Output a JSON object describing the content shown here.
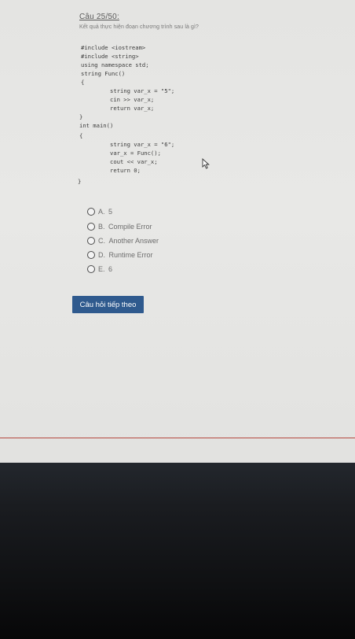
{
  "question": {
    "title": "Câu 25/50:",
    "text": "Kết quả thực hiện đoạn chương trình sau là gì?"
  },
  "code_lines": [
    "#include <iostream>",
    "#include <string>",
    "using namespace std;",
    "string Func()",
    "{",
    "string var_x = \"5\";",
    "cin >> var_x;",
    "return var_x;",
    "}",
    "int main()",
    "{",
    "string var_x = \"6\";",
    "var_x = Func();",
    "cout << var_x;",
    "return 0;",
    "}"
  ],
  "answers": [
    {
      "letter": "A.",
      "text": "5"
    },
    {
      "letter": "B.",
      "text": "Compile Error"
    },
    {
      "letter": "C.",
      "text": "Another Answer"
    },
    {
      "letter": "D.",
      "text": "Runtime Error"
    },
    {
      "letter": "E.",
      "text": "6"
    }
  ],
  "next_button": "Câu hỏi tiếp theo",
  "colors": {
    "button": "#2f5a8e",
    "divider": "#b54a40",
    "screen_bg": "#e6e6e4"
  }
}
